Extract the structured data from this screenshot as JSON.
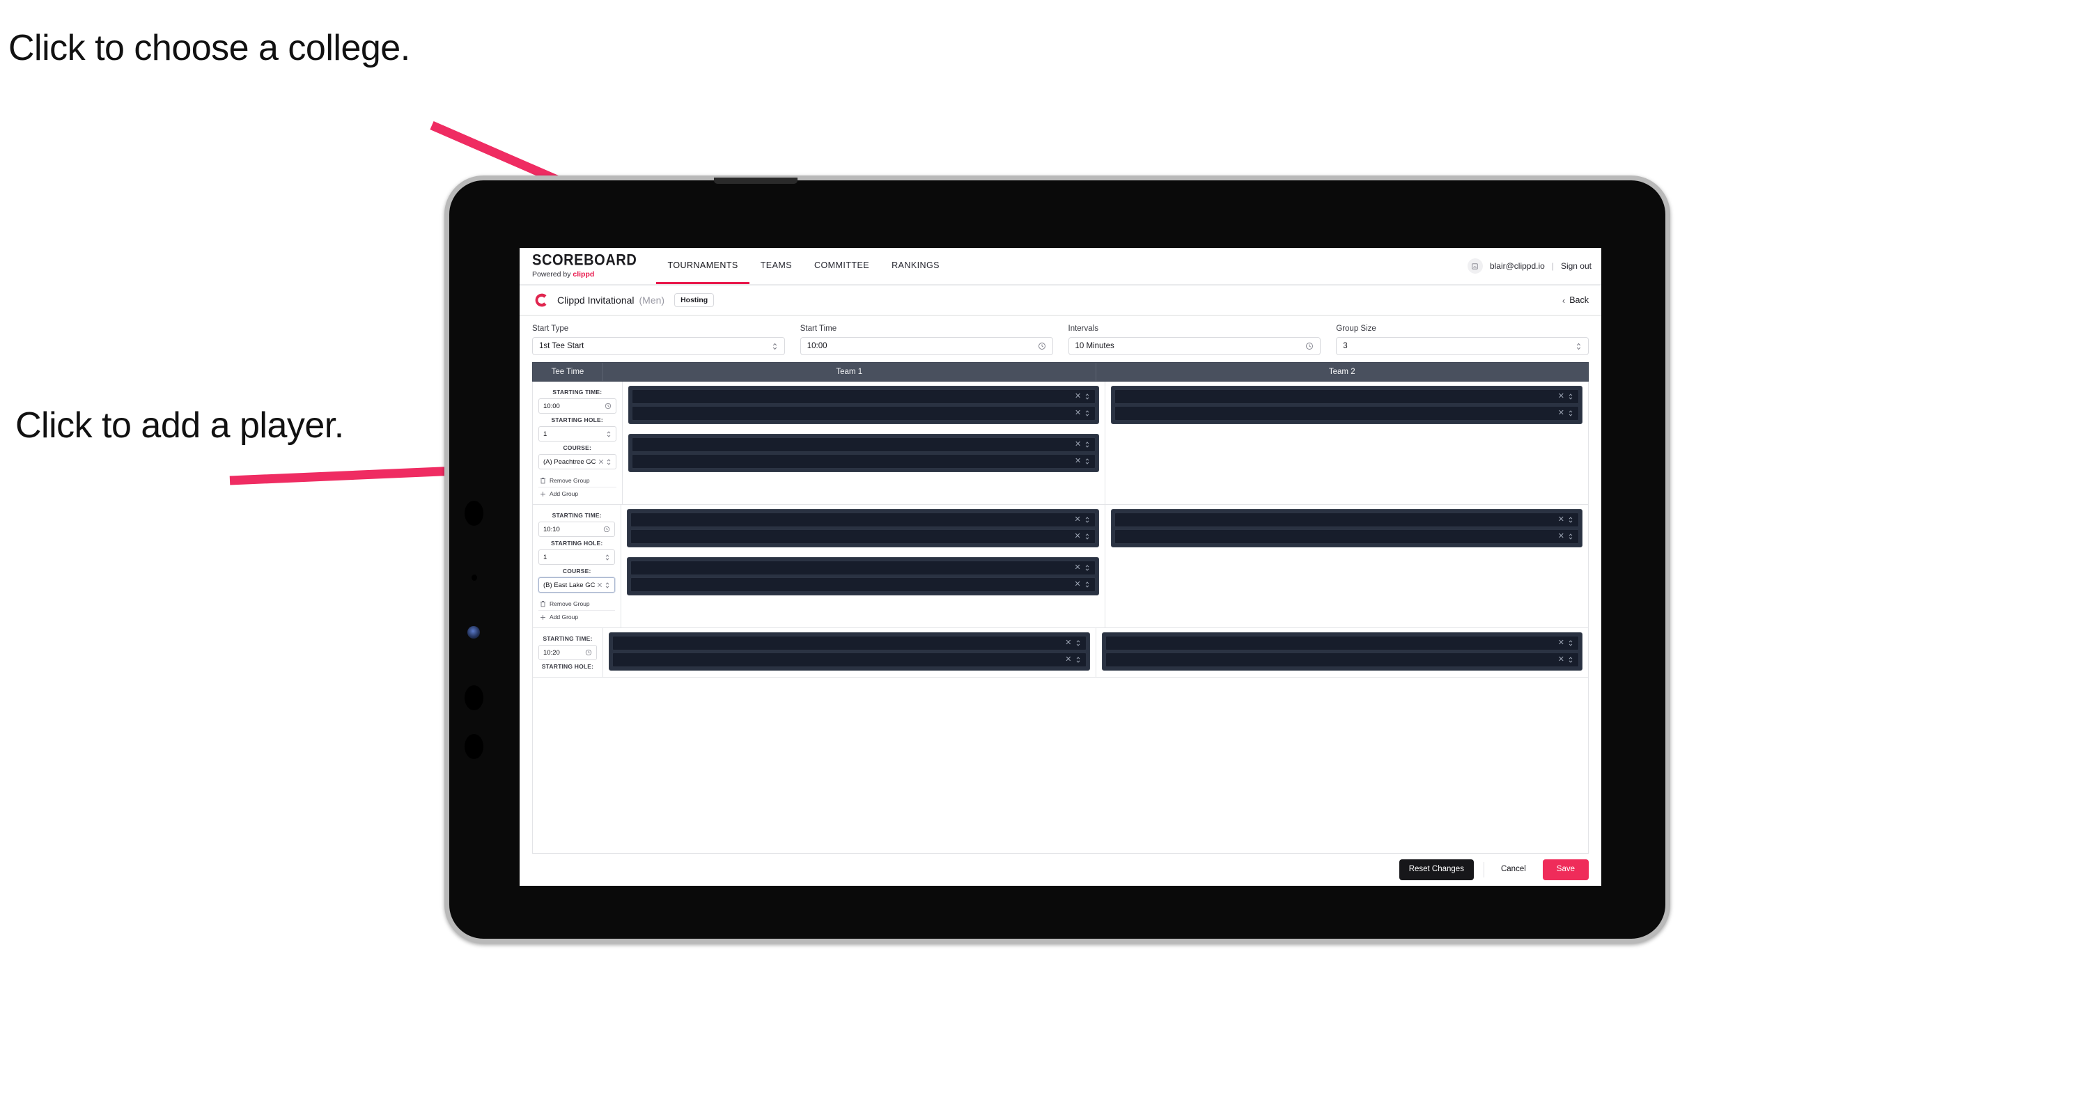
{
  "annotations": [
    {
      "id": "college",
      "text": "Click to choose a college."
    },
    {
      "id": "player",
      "text": "Click to add a player."
    }
  ],
  "accent": {
    "pink": "#e8174b",
    "arrow": "#ef2c62",
    "save": "#ef2c5a",
    "header_bg": "#49505e",
    "panel_bg": "#2a3242",
    "slot_bg": "#171d2b"
  },
  "topnav": {
    "brand": {
      "main": "SCOREBOARD",
      "sub_prefix": "Powered by ",
      "sub_brand": "clippd"
    },
    "tabs": [
      {
        "label": "TOURNAMENTS",
        "active": true
      },
      {
        "label": "TEAMS",
        "active": false
      },
      {
        "label": "COMMITTEE",
        "active": false
      },
      {
        "label": "RANKINGS",
        "active": false
      }
    ],
    "avatar_icon": "user-avatar-icon",
    "email": "blair@clippd.io",
    "separator": "|",
    "signout": "Sign out"
  },
  "tournament_bar": {
    "logo_icon": "clippd-c-logo-icon",
    "title": "Clippd Invitational",
    "gender": "(Men)",
    "badge": "Hosting",
    "back_label": "Back",
    "back_icon": "chevron-left-icon"
  },
  "filters": [
    {
      "label": "Start Type",
      "value": "1st Tee Start",
      "icon": "stepper-updown-icon",
      "name": "start-type"
    },
    {
      "label": "Start Time",
      "value": "10:00",
      "icon": "clock-icon",
      "name": "start-time"
    },
    {
      "label": "Intervals",
      "value": "10 Minutes",
      "icon": "clock-icon",
      "name": "intervals"
    },
    {
      "label": "Group Size",
      "value": "3",
      "icon": "stepper-updown-icon",
      "name": "group-size"
    }
  ],
  "table": {
    "headers": {
      "tee_time": "Tee Time",
      "team1": "Team 1",
      "team2": "Team 2"
    },
    "captions": {
      "starting_time": "STARTING TIME:",
      "starting_hole": "STARTING HOLE:",
      "course": "COURSE:"
    },
    "actions": {
      "remove_group": "Remove Group",
      "add_group": "Add Group",
      "remove_icon": "trash-icon",
      "add_icon": "plus-icon"
    },
    "slot_icons": {
      "clear": "clear-x-icon",
      "stepper": "stepper-updown-icon"
    },
    "groups": [
      {
        "starting_time": "10:00",
        "starting_hole": "1",
        "course": "(A) Peachtree GC",
        "course_focused": false,
        "team1_players": [
          "",
          ""
        ],
        "team1_players_b": [
          "",
          ""
        ],
        "team2_players": [
          "",
          ""
        ],
        "team2_players_b": []
      },
      {
        "starting_time": "10:10",
        "starting_hole": "1",
        "course": "(B) East Lake GC",
        "course_focused": true,
        "team1_players": [
          "",
          ""
        ],
        "team1_players_b": [
          "",
          ""
        ],
        "team2_players": [
          "",
          ""
        ],
        "team2_players_b": []
      },
      {
        "starting_time": "10:20",
        "starting_hole": "",
        "course": "",
        "course_focused": false,
        "team1_players": [
          "",
          ""
        ],
        "team1_players_b": [],
        "team2_players": [
          "",
          ""
        ],
        "team2_players_b": []
      }
    ]
  },
  "footer": {
    "reset": "Reset Changes",
    "cancel": "Cancel",
    "save": "Save"
  }
}
